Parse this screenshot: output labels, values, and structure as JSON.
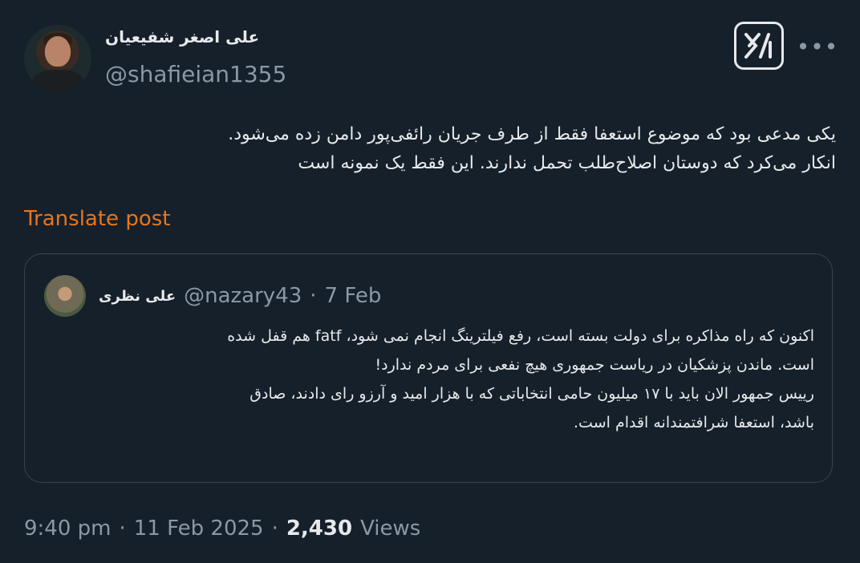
{
  "author": {
    "display_name": "علی اصغر شفیعیان",
    "handle": "@shafieian1355"
  },
  "post": {
    "text": "یکی مدعی بود که موضوع استعفا فقط از طرف جریان رائفی‌پور دامن زده می‌شود.\nانکار می‌کرد که دوستان اصلاح‌طلب تحمل ندارند. این فقط یک نمونه است"
  },
  "translate_label": "Translate post",
  "quote": {
    "display_name": "علی نظری",
    "handle": "@nazary43",
    "separator": "·",
    "date": "7 Feb",
    "text": "اکنون که راه مذاکره برای دولت بسته است، رفع فیلترینگ انجام نمی شود، fatf هم قفل شده\nاست. ماندن پزشکیان در ریاست جمهوری هیچ نفعی برای مردم ندارد!\nرییس جمهور الان باید با ۱۷ میلیون حامی انتخاباتی که با هزار امید و آرزو رای دادند، صادق\nباشد، استعفا شرافتمندانه اقدام است."
  },
  "meta": {
    "time": "9:40 pm",
    "separator": "·",
    "date": "11 Feb 2025",
    "separator2": "·",
    "views_count": "2,430",
    "views_label": "Views"
  },
  "icons": {
    "grok": "grok-icon",
    "more": "more-icon"
  },
  "colors": {
    "background": "#15202b",
    "accent_translate": "#e8751a",
    "secondary_text": "#8b98a5",
    "border": "#38444d"
  }
}
